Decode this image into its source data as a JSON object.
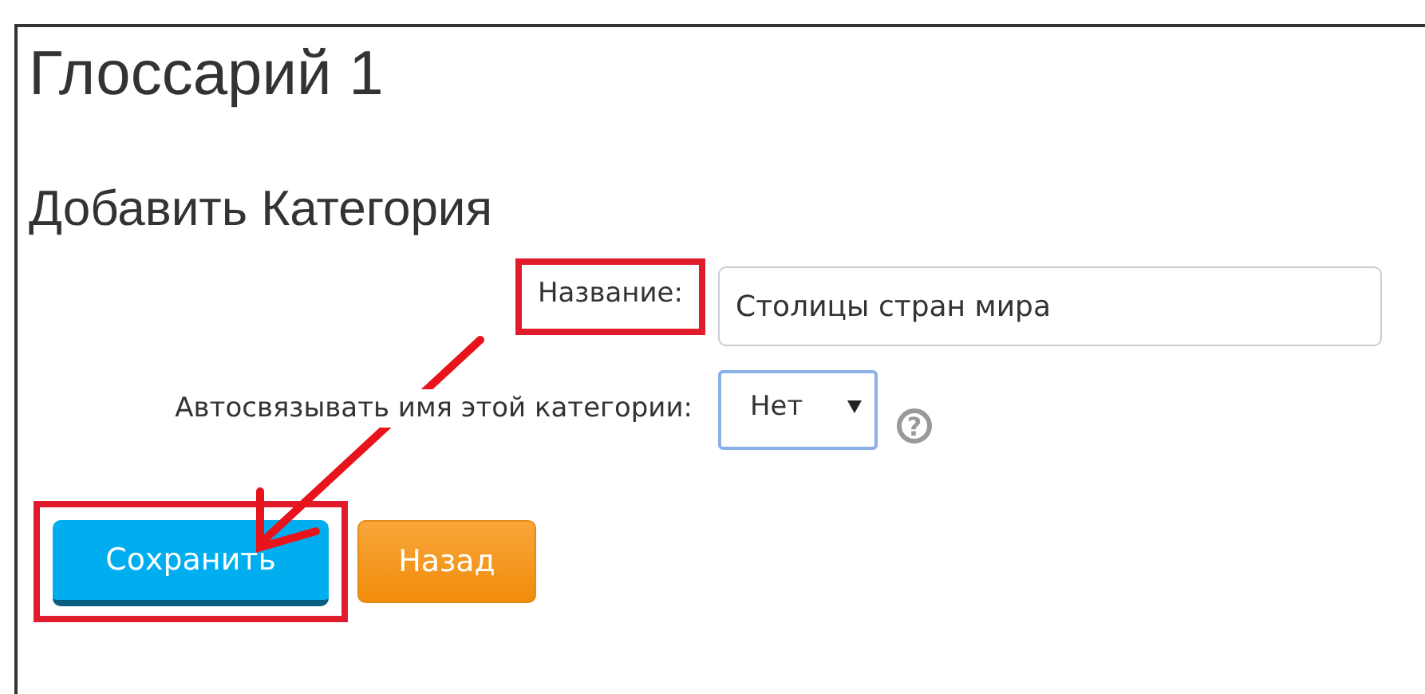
{
  "page_title": "Глоссарий 1",
  "form_title": "Добавить Категория",
  "fields": [
    {
      "kind": "text",
      "label": "Название:",
      "value": "Столицы стран мира",
      "highlighted": true
    },
    {
      "kind": "select",
      "label": "Автосвязывать имя этой категории:",
      "value": "Нет",
      "help": "?",
      "highlighted": false
    }
  ],
  "buttons": [
    {
      "label": "Сохранить",
      "kind": "primary",
      "highlighted": true
    },
    {
      "label": "Назад",
      "kind": "secondary",
      "highlighted": false
    }
  ]
}
